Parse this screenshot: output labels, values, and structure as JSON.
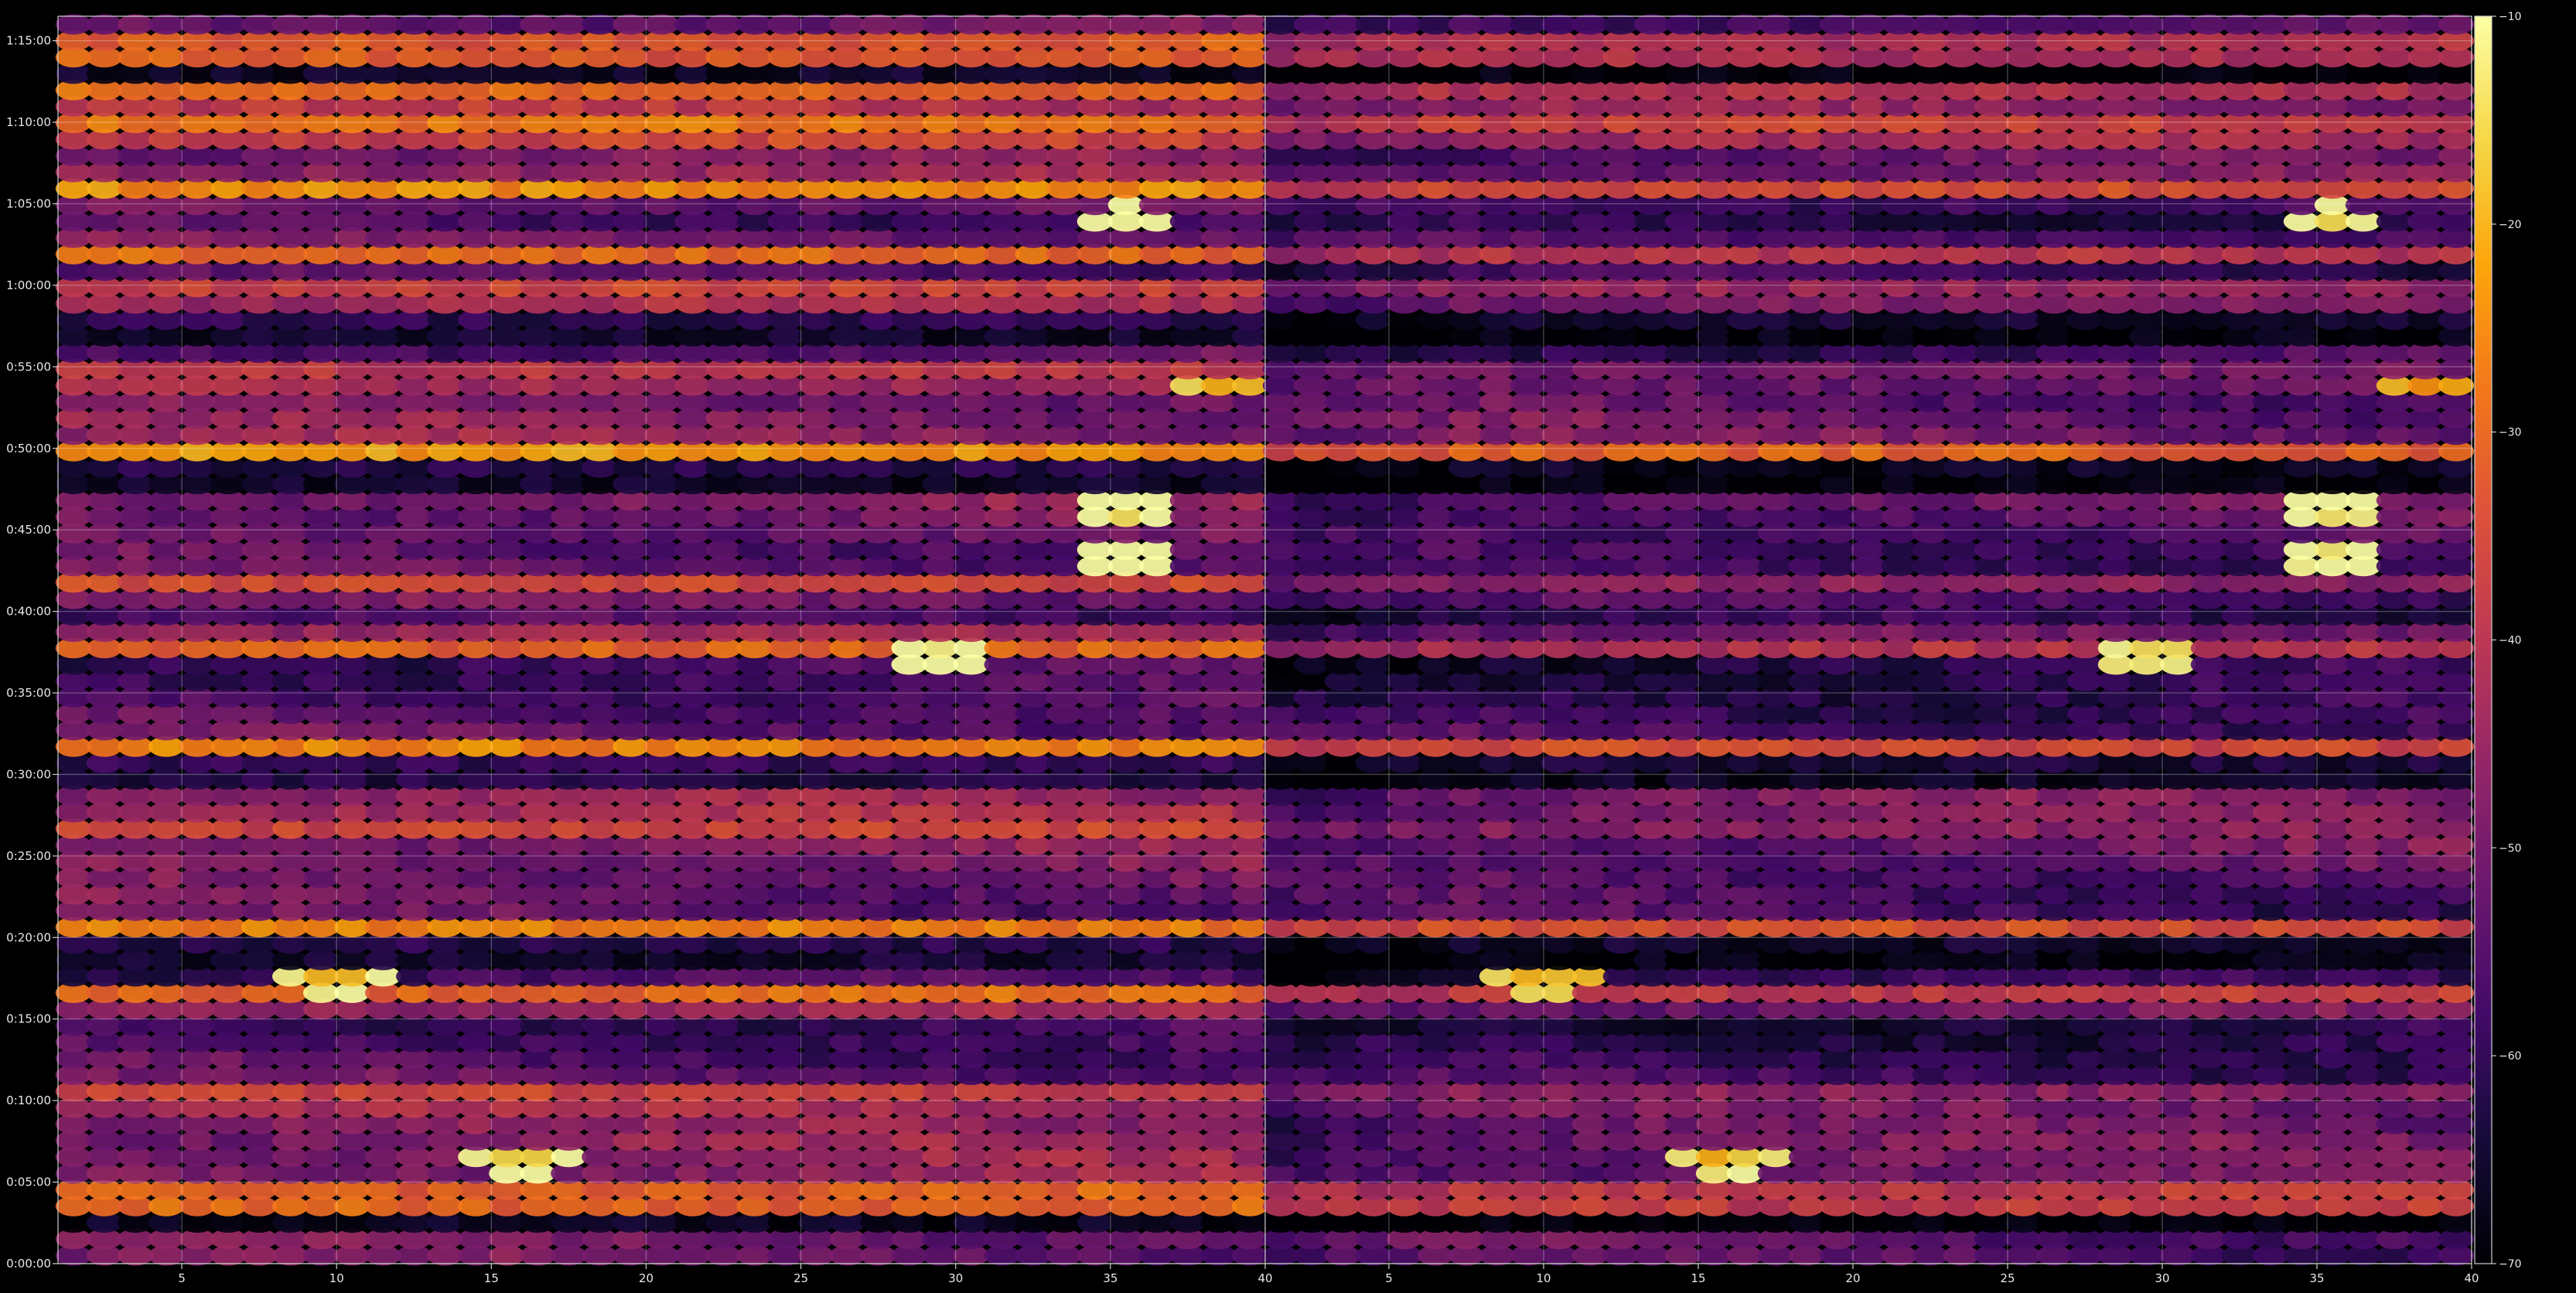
{
  "chart_data": {
    "type": "heatmap",
    "title": "",
    "xlabel": "",
    "ylabel": "",
    "colormap": "inferno",
    "background": "#000000",
    "grid": true,
    "legend": "colorbar-right",
    "colorbar": {
      "range": [
        -70,
        -10
      ],
      "ticks": [
        -70,
        -60,
        -50,
        -40,
        -30,
        -20,
        -10
      ],
      "tick_labels": [
        "−70",
        "−60",
        "−50",
        "−40",
        "−30",
        "−20",
        "−10"
      ]
    },
    "panels": [
      {
        "name": "",
        "xlim": [
          1,
          40
        ],
        "x_ticks": [
          5,
          10,
          15,
          20,
          25,
          30,
          35,
          40
        ],
        "x_tick_labels": [
          "5",
          "10",
          "15",
          "20",
          "25",
          "30",
          "35",
          "40"
        ],
        "x_bins": 39
      },
      {
        "name": "",
        "xlim": [
          1,
          40
        ],
        "x_ticks": [
          5,
          10,
          15,
          20,
          25,
          30,
          35,
          40
        ],
        "x_tick_labels": [
          "5",
          "10",
          "15",
          "20",
          "25",
          "30",
          "35",
          "40"
        ],
        "x_bins": 39
      }
    ],
    "y_axis": {
      "unit": "seconds",
      "ylim": [
        0,
        4590
      ],
      "ticks": [
        0,
        300,
        600,
        900,
        1200,
        1500,
        1800,
        2100,
        2400,
        2700,
        3000,
        3300,
        3600,
        3900,
        4200,
        4500
      ],
      "tick_labels": [
        "0:00:00",
        "0:05:00",
        "0:10:00",
        "0:15:00",
        "0:20:00",
        "0:25:00",
        "0:30:00",
        "0:35:00",
        "0:40:00",
        "0:45:00",
        "0:50:00",
        "0:55:00",
        "1:00:00",
        "1:05:00",
        "1:10:00",
        "1:15:00"
      ],
      "time_bins": 76
    },
    "bright_bands": [
      {
        "t": 4470,
        "level": -20,
        "panel2_offset": -8
      },
      {
        "t": 4310,
        "level": -27,
        "panel2_offset": -8
      },
      {
        "t": 4180,
        "level": -22,
        "panel2_offset": -6
      },
      {
        "t": 3960,
        "level": -22,
        "panel2_offset": -7
      },
      {
        "t": 3720,
        "level": -27,
        "panel2_offset": -7
      },
      {
        "t": 3570,
        "level": -27,
        "panel2_offset": -7
      },
      {
        "t": 3270,
        "level": -33,
        "panel2_offset": -10
      },
      {
        "t": 2970,
        "level": -15,
        "panel2_offset": -5
      },
      {
        "t": 2500,
        "level": -33,
        "panel2_offset": -8
      },
      {
        "t": 2280,
        "level": -23,
        "panel2_offset": -8
      },
      {
        "t": 1890,
        "level": -21,
        "panel2_offset": -6
      },
      {
        "t": 1610,
        "level": -34,
        "panel2_offset": -8
      },
      {
        "t": 1220,
        "level": -17,
        "panel2_offset": -5
      },
      {
        "t": 980,
        "level": -21,
        "panel2_offset": -6
      },
      {
        "t": 620,
        "level": -33,
        "panel2_offset": -8
      },
      {
        "t": 240,
        "level": -18,
        "panel2_offset": -6
      }
    ],
    "dark_bands": [
      {
        "t": 4380,
        "level": -66
      },
      {
        "t": 3420,
        "level": -66
      },
      {
        "t": 2880,
        "level": -67
      },
      {
        "t": 1800,
        "level": -64
      },
      {
        "t": 1130,
        "level": -66
      },
      {
        "t": 150,
        "level": -67
      }
    ],
    "hot_spots": [
      {
        "x": 35.5,
        "t": 3840,
        "level": -13
      },
      {
        "x": 35.5,
        "t": 2760,
        "level": -13
      },
      {
        "x": 35.5,
        "t": 2600,
        "level": -12
      },
      {
        "x": 29.5,
        "t": 2240,
        "level": -15
      },
      {
        "x": 39,
        "t": 3230,
        "level": -20
      },
      {
        "x": 16,
        "t": 390,
        "level": -17
      },
      {
        "x": 10,
        "t": 1050,
        "level": -19
      }
    ]
  }
}
